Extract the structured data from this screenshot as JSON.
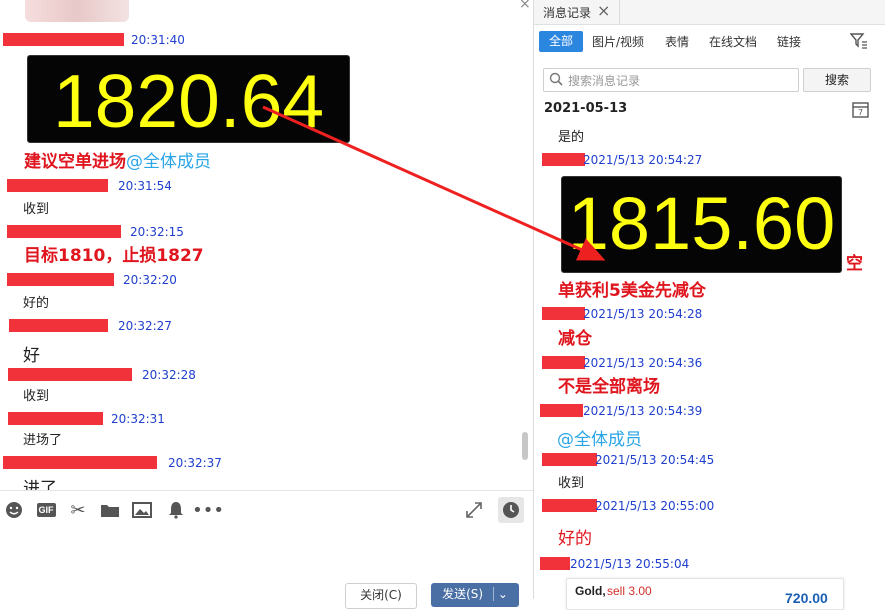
{
  "chat": {
    "messages": [
      {
        "time": "20:31:40"
      },
      {
        "board_value": "1820.64"
      },
      {
        "text": "建议空单进场",
        "mention": "@全体成员"
      },
      {
        "time": "20:31:54"
      },
      {
        "text": "收到"
      },
      {
        "time": "20:32:15"
      },
      {
        "text": "目标1810，止损1827"
      },
      {
        "time": "20:32:20"
      },
      {
        "text": "好的"
      },
      {
        "time": "20:32:27"
      },
      {
        "text": "好"
      },
      {
        "time": "20:32:28"
      },
      {
        "text": "收到"
      },
      {
        "time": "20:32:31"
      },
      {
        "text": "进场了"
      },
      {
        "time": "20:32:37"
      },
      {
        "text": "进了"
      }
    ],
    "footer": {
      "close_label": "关闭(C)",
      "send_label": "发送(S)"
    },
    "toolbar_icons": [
      "emoji-icon",
      "gif-icon",
      "scissors-icon",
      "folder-icon",
      "image-icon",
      "bell-icon",
      "more-icon",
      "expand-icon",
      "history-clock-icon"
    ]
  },
  "history": {
    "title": "消息记录",
    "close_glyph": "×",
    "tabs": [
      "全部",
      "图片/视频",
      "表情",
      "在线文档",
      "链接"
    ],
    "active_tab": "全部",
    "search_placeholder": "搜索消息记录",
    "search_button": "搜索",
    "date": "2021-05-13",
    "entries": [
      {
        "text": "是的"
      },
      {
        "time": "2021/5/13 20:54:27"
      },
      {
        "board_value": "1815.60",
        "trail": "空"
      },
      {
        "text": "单获利5美金先减仓"
      },
      {
        "time": "2021/5/13 20:54:28"
      },
      {
        "text": "减仓"
      },
      {
        "time": "2021/5/13 20:54:36"
      },
      {
        "text": "不是全部离场"
      },
      {
        "time": "2021/5/13 20:54:39"
      },
      {
        "text": "@全体成员"
      },
      {
        "time": "2021/5/13 20:54:45"
      },
      {
        "text": "收到"
      },
      {
        "time": "2021/5/13 20:55:00"
      },
      {
        "text": "好的"
      },
      {
        "time": "2021/5/13 20:55:04"
      }
    ],
    "card": {
      "title": "Gold,",
      "sell_label": "sell 3.00",
      "amount": "720.00"
    }
  },
  "colors": {
    "accent": "#2b86e0",
    "red_text": "#e0161f",
    "time_blue": "#1f3fcf",
    "board_digits": "#ffff10",
    "redaction": "#f2323a"
  }
}
